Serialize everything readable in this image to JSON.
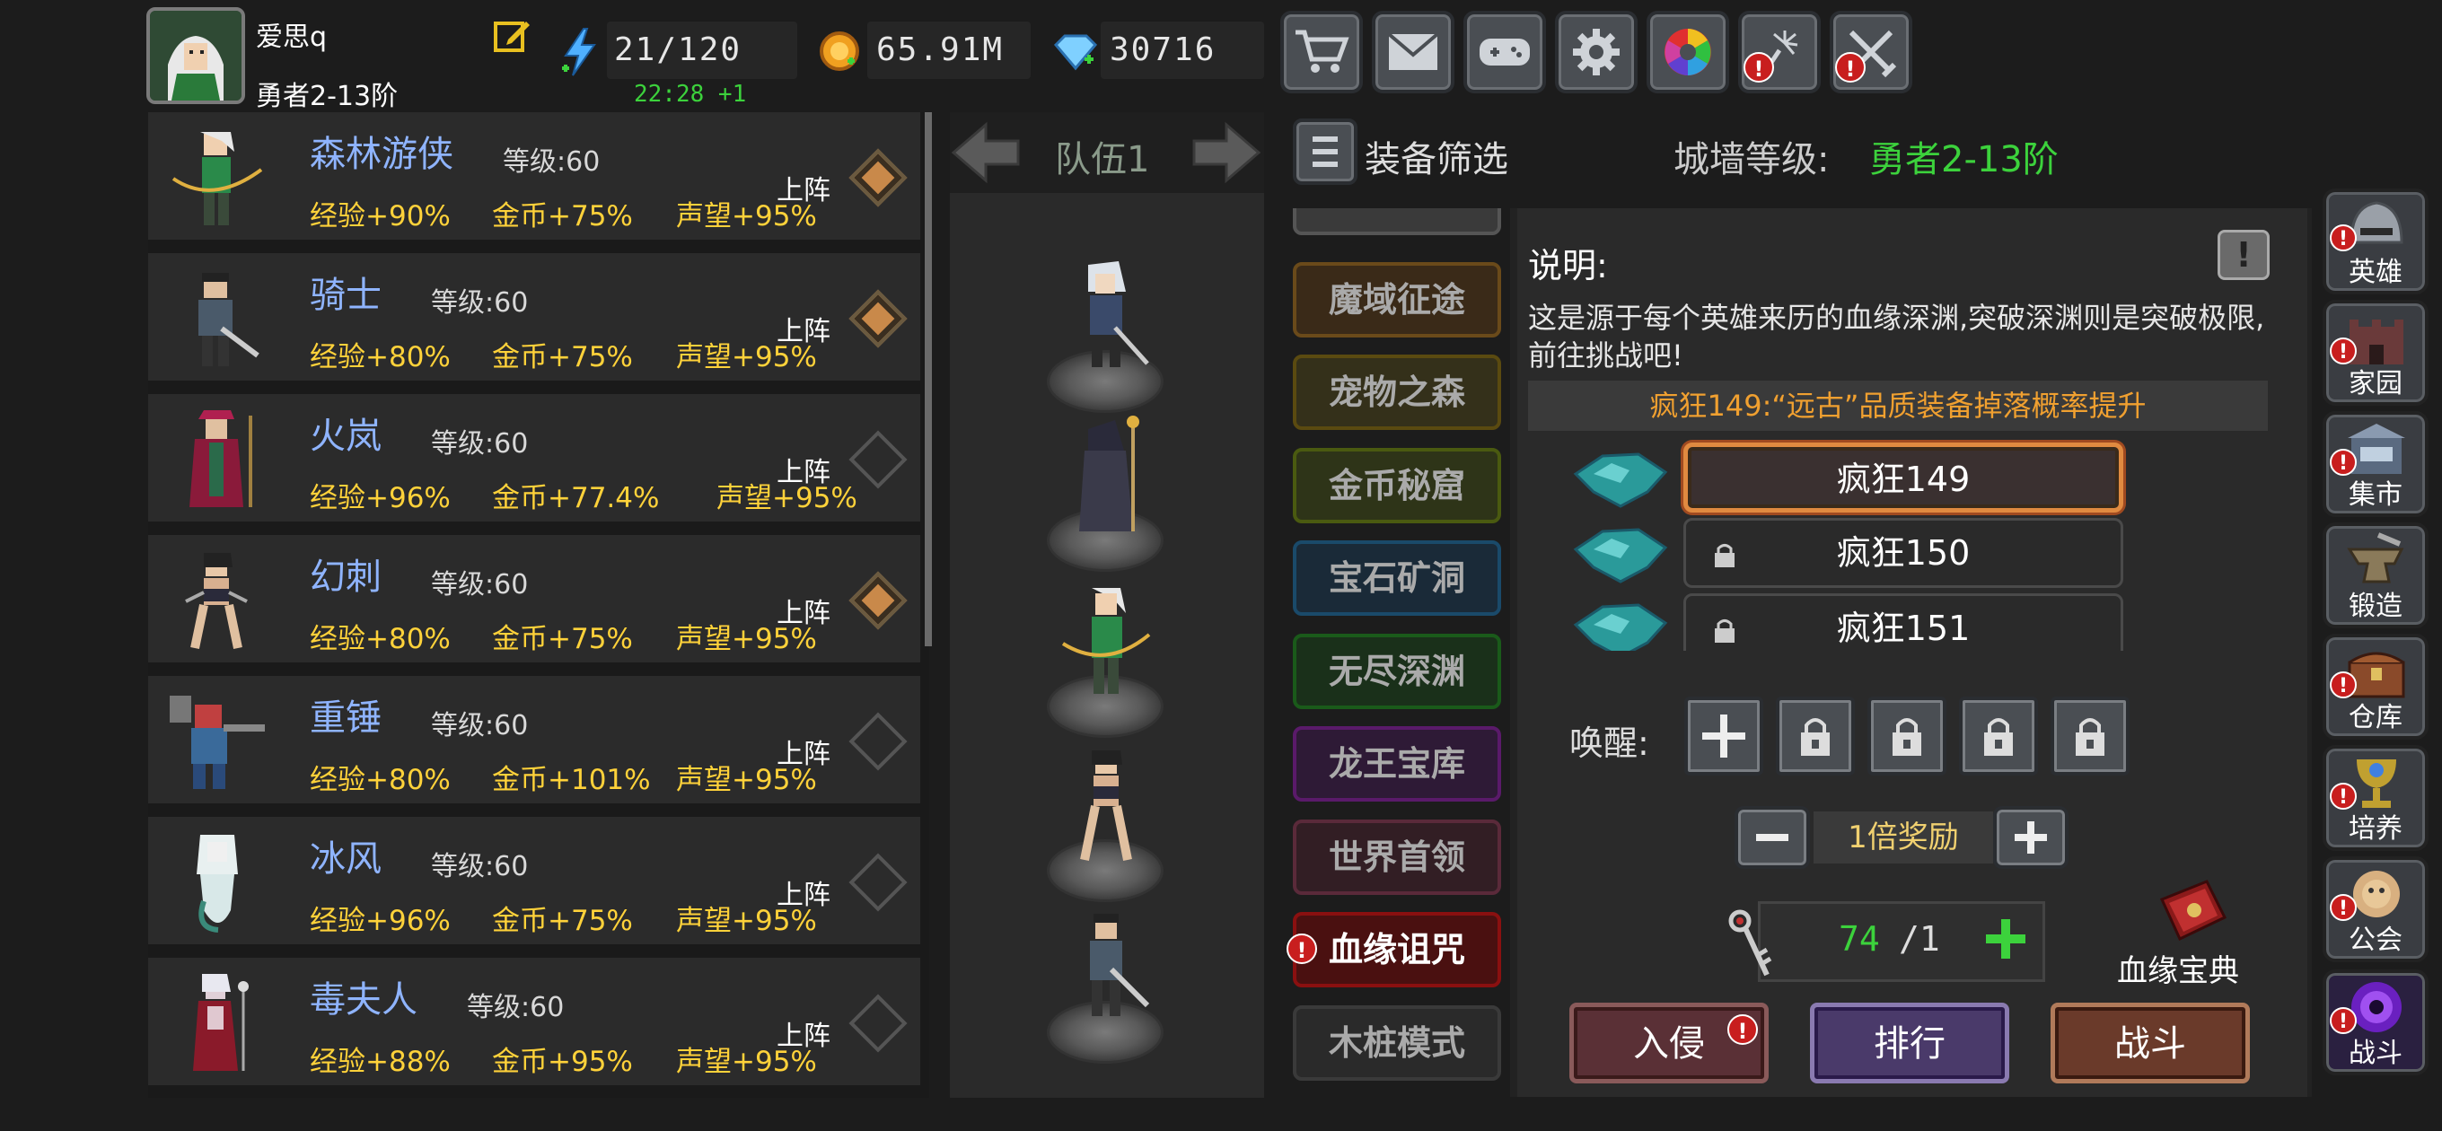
{
  "player": {
    "name": "爱思q",
    "rank": "勇者2-13阶",
    "energy": "21/120",
    "energy_timer": "22:28 +1",
    "gold": "65.91M",
    "gems": "30716"
  },
  "top_buttons": [
    {
      "icon": "cart-icon",
      "alert": false
    },
    {
      "icon": "mail-icon",
      "alert": false
    },
    {
      "icon": "gamepad-icon",
      "alert": false
    },
    {
      "icon": "gear-icon",
      "alert": false
    },
    {
      "icon": "color-wheel-icon",
      "alert": false
    },
    {
      "icon": "fireworks-icon",
      "alert": true
    },
    {
      "icon": "crossed-swords-icon",
      "alert": true
    }
  ],
  "heroes": [
    {
      "name": "森林游侠",
      "level": "等级:60",
      "exp": "经验+90%",
      "gold": "金币+75%",
      "fame": "声望+95%",
      "deploy": "上阵",
      "active": true
    },
    {
      "name": "骑士",
      "level": "等级:60",
      "exp": "经验+80%",
      "gold": "金币+75%",
      "fame": "声望+95%",
      "deploy": "上阵",
      "active": true
    },
    {
      "name": "火岚",
      "level": "等级:60",
      "exp": "经验+96%",
      "gold": "金币+77.4%",
      "fame": "声望+95%",
      "deploy": "上阵",
      "active": false
    },
    {
      "name": "幻刺",
      "level": "等级:60",
      "exp": "经验+80%",
      "gold": "金币+75%",
      "fame": "声望+95%",
      "deploy": "上阵",
      "active": true
    },
    {
      "name": "重锤",
      "level": "等级:60",
      "exp": "经验+80%",
      "gold": "金币+101%",
      "fame": "声望+95%",
      "deploy": "上阵",
      "active": false
    },
    {
      "name": "冰风",
      "level": "等级:60",
      "exp": "经验+96%",
      "gold": "金币+75%",
      "fame": "声望+95%",
      "deploy": "上阵",
      "active": false
    },
    {
      "name": "毒夫人",
      "level": "等级:60",
      "exp": "经验+88%",
      "gold": "金币+95%",
      "fame": "声望+95%",
      "deploy": "上阵",
      "active": false
    }
  ],
  "team": {
    "name": "队伍1"
  },
  "filter": {
    "label": "装备筛选",
    "wall_label": "城墙等级:",
    "wall_value": "勇者2-13阶"
  },
  "modes": [
    {
      "label": "魔域征途",
      "color": "#6a4a1a"
    },
    {
      "label": "宠物之森",
      "color": "#5a4a10"
    },
    {
      "label": "金币秘窟",
      "color": "#4a5a10"
    },
    {
      "label": "宝石矿洞",
      "color": "#1a4a6a"
    },
    {
      "label": "无尽深渊",
      "color": "#1a5a1a"
    },
    {
      "label": "龙王宝库",
      "color": "#5a1a6a"
    },
    {
      "label": "世界首领",
      "color": "#5a2a3a"
    },
    {
      "label": "血缘诅咒",
      "color": "#8a1010"
    },
    {
      "label": "木桩模式",
      "color": "#3a3a3a"
    }
  ],
  "details": {
    "title": "说明:",
    "description": "这是源于每个英雄来历的血缘深渊,突破深渊则是突破极限,前往挑战吧!",
    "bonus": "疯狂149:“远古”品质装备掉落概率提升",
    "stages": [
      {
        "label": "疯狂149",
        "locked": false,
        "selected": true
      },
      {
        "label": "疯狂150",
        "locked": true,
        "selected": false
      },
      {
        "label": "疯狂151",
        "locked": true,
        "selected": false
      }
    ],
    "awaken_label": "唤醒:",
    "reward_label": "1倍奖励",
    "ticket_count": "74",
    "ticket_total": "/1",
    "codex_label": "血缘宝典"
  },
  "actions": {
    "invade": "入侵",
    "rank": "排行",
    "battle": "战斗"
  },
  "nav": [
    {
      "label": "英雄",
      "icon": "helmet-icon",
      "alert": true
    },
    {
      "label": "家园",
      "icon": "castle-icon",
      "alert": true
    },
    {
      "label": "集市",
      "icon": "market-icon",
      "alert": true
    },
    {
      "label": "锻造",
      "icon": "anvil-icon",
      "alert": false
    },
    {
      "label": "仓库",
      "icon": "chest-icon",
      "alert": true
    },
    {
      "label": "培养",
      "icon": "chalice-icon",
      "alert": true
    },
    {
      "label": "公会",
      "icon": "guild-icon",
      "alert": true
    },
    {
      "label": "战斗",
      "icon": "portal-icon",
      "alert": true
    }
  ],
  "colors": {
    "green": "#3cd23c",
    "gold": "#ffd23a",
    "hero_name": "#8fb4ff",
    "alert": "#c81e1e"
  }
}
